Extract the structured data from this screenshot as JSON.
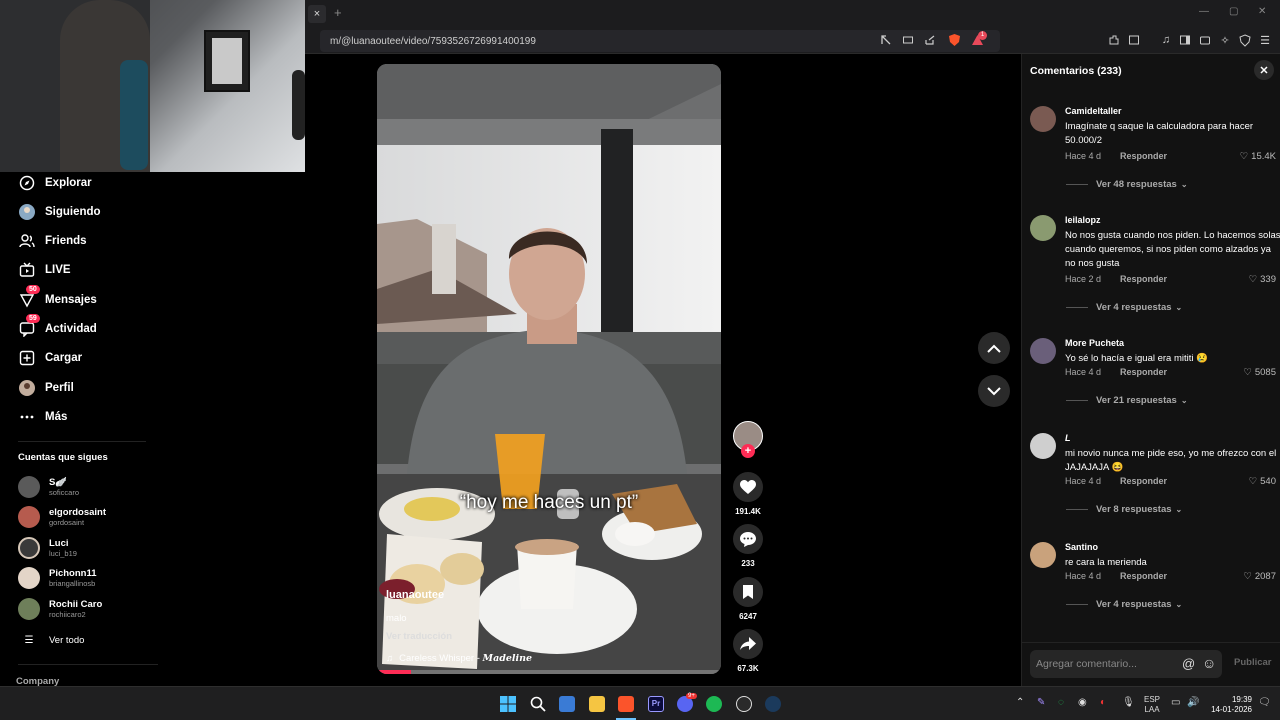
{
  "browser": {
    "url": "m/@luanaoutee/video/7593526726991400199",
    "tab_close": "×",
    "tab_add": "+",
    "window_controls": [
      "—",
      "▢",
      "✕"
    ],
    "extension_badge": "1"
  },
  "sidebar": {
    "items": [
      {
        "label": "Explorar",
        "icon": "compass-icon"
      },
      {
        "label": "Siguiendo",
        "icon": "following-avatar-icon"
      },
      {
        "label": "Friends",
        "icon": "friends-icon"
      },
      {
        "label": "LIVE",
        "icon": "live-tv-icon"
      },
      {
        "label": "Mensajes",
        "icon": "messages-icon",
        "badge": "50"
      },
      {
        "label": "Actividad",
        "icon": "activity-icon",
        "badge": "59"
      },
      {
        "label": "Cargar",
        "icon": "upload-icon"
      },
      {
        "label": "Perfil",
        "icon": "profile-avatar-icon"
      },
      {
        "label": "Más",
        "icon": "more-dots-icon"
      }
    ],
    "following_title": "Cuentas que sigues",
    "following": [
      {
        "name": "S🪽",
        "handle": "soficcaro",
        "color": "#5a5a5a"
      },
      {
        "name": "elgordosaint",
        "handle": "gordosaint",
        "color": "#b65b4e"
      },
      {
        "name": "Luci",
        "handle": "luci_b19",
        "color": "#d6c7b8"
      },
      {
        "name": "Pichonn11",
        "handle": "briangallinosb",
        "color": "#e3d5c8"
      },
      {
        "name": "Rochii Caro",
        "handle": "rochiicaro2",
        "color": "#6e7f5a"
      }
    ],
    "see_all": "Ver todo",
    "company": "Company"
  },
  "video": {
    "caption_overlay": "“hoy me haces un pt”",
    "author": "luanaoutee",
    "description": "malo",
    "translate": "Ver traducción",
    "music_title": "Careless Whisper",
    "music_sep": " - ",
    "music_artist": "Madeline",
    "progress": 0.1
  },
  "actions": {
    "likes": "191.4K",
    "comments": "233",
    "saves": "6247",
    "shares": "67.3K"
  },
  "comments_panel": {
    "title": "Comentarios",
    "count": "(233)",
    "reply_label": "Responder",
    "input_placeholder": "Agregar comentario...",
    "publish": "Publicar",
    "items": [
      {
        "user": "Camideltaller",
        "text": "Imagínate q saque la calculadora para hacer 50.000/2",
        "time": "Hace 4 d",
        "likes": "15.4K",
        "more": "Ver 48 respuestas",
        "color": "#7a5a52"
      },
      {
        "user": "leilalopz",
        "text": "No nos gusta cuando nos piden. Lo hacemos solas cuando queremos, si nos piden como alzados ya no nos gusta",
        "time": "Hace 2 d",
        "likes": "339",
        "more": "Ver 4 respuestas",
        "color": "#8a9a70"
      },
      {
        "user": "More Pucheta",
        "text": "Yo sé lo hacía e igual era mititi 😢",
        "time": "Hace 4 d",
        "likes": "5085",
        "more": "Ver 21 respuestas",
        "color": "#6a5f7a"
      },
      {
        "user": "L",
        "text": "mi novio nunca me pide eso, yo me ofrezco con el JAJAJAJA 😆",
        "time": "Hace 4 d",
        "likes": "540",
        "more": "Ver 8 respuestas",
        "color": "#cfcfcf"
      },
      {
        "user": "Santino",
        "text": "re cara la merienda",
        "time": "Hace 4 d",
        "likes": "2087",
        "more": "Ver 4 respuestas",
        "color": "#c9a27c"
      }
    ]
  },
  "taskbar": {
    "lang": "ESP",
    "lang2": "LAA",
    "time": "19:39",
    "date": "14-01-2026",
    "discord_badge": "9+"
  }
}
